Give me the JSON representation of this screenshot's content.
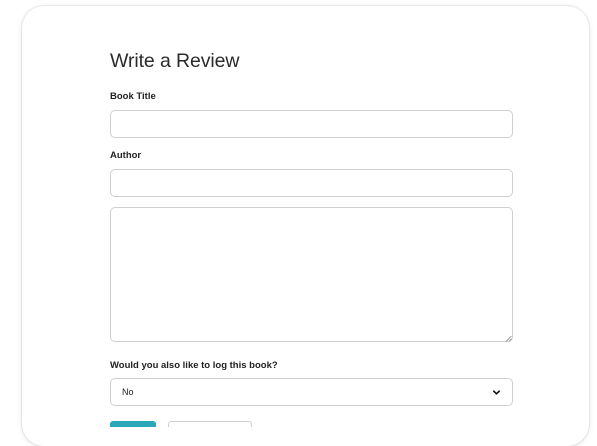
{
  "form": {
    "title": "Write a Review",
    "book_title_label": "Book Title",
    "book_title_value": "",
    "author_label": "Author",
    "author_value": "",
    "review_value": "",
    "log_label": "Would you also like to log this book?",
    "log_selected": "No"
  },
  "icons": {
    "select_chevron": "chevron-down-icon",
    "resize": "resize-grip-icon"
  },
  "colors": {
    "primary_button": "#2aa7b9",
    "border": "#cfcfcf",
    "text": "#222222"
  }
}
